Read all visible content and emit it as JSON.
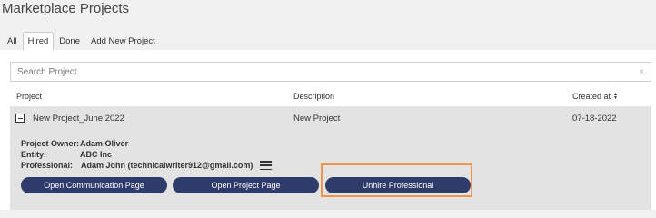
{
  "page": {
    "title": "Marketplace Projects"
  },
  "tabs": [
    {
      "label": "All",
      "active": false
    },
    {
      "label": "Hired",
      "active": true
    },
    {
      "label": "Done",
      "active": false
    },
    {
      "label": "Add New Project",
      "active": false
    }
  ],
  "search": {
    "placeholder": "Search Project",
    "value": "",
    "clear_icon": "×"
  },
  "table": {
    "columns": {
      "project": "Project",
      "description": "Description",
      "created_at": "Created at"
    },
    "rows": [
      {
        "project": "New Project_June 2022",
        "description": "New Project",
        "created_at": "07-18-2022",
        "details": {
          "owner_label": "Project Owner:",
          "owner_value": "Adam Oliver",
          "entity_label": "Entity:",
          "entity_value": "ABC Inc",
          "professional_label": "Professional:",
          "professional_value": "Adam John (technicalwriter912@gmail.com)"
        },
        "actions": {
          "open_communication": "Open Communication Page",
          "open_project": "Open Project Page",
          "unhire": "Unhire Professional"
        }
      }
    ]
  },
  "colors": {
    "button_bg": "#2f3b6b",
    "highlight": "#f0954a",
    "row_bg": "#e3e3e3"
  }
}
